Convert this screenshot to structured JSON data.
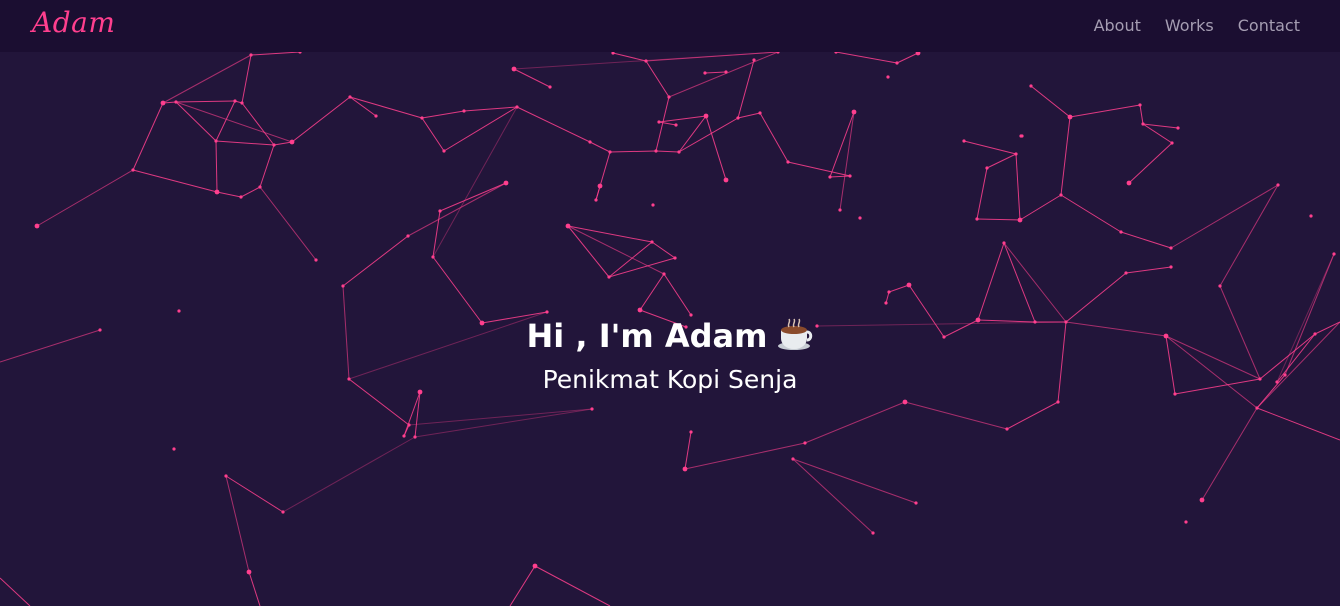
{
  "brand": {
    "name": "Adam"
  },
  "nav": {
    "items": [
      {
        "label": "About"
      },
      {
        "label": "Works"
      },
      {
        "label": "Contact"
      }
    ]
  },
  "hero": {
    "greeting": "Hi , I'm Adam",
    "emoji_icon": "coffee-cup-icon",
    "tagline": "Penikmat Kopi Senja"
  },
  "theme": {
    "background": "#22153a",
    "navbar_background": "#1b0e31",
    "accent": "#ff3f8e",
    "nav_text": "#a59db2",
    "hero_text": "#ffffff"
  }
}
